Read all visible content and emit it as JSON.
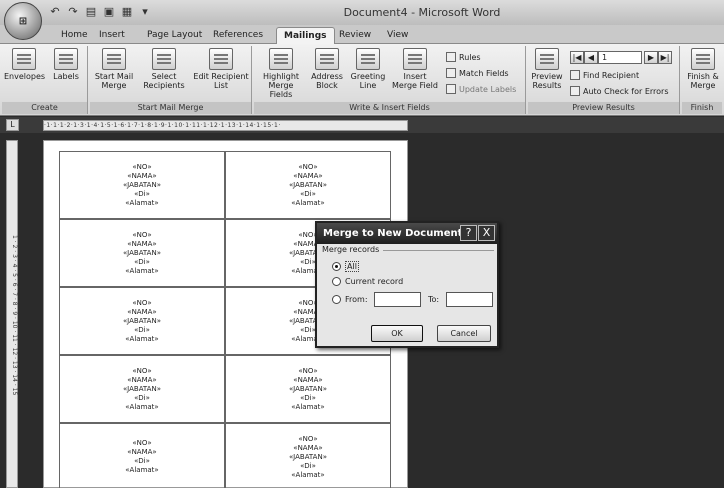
{
  "app": {
    "office_button_label": "Office",
    "qat_icons": [
      "save-icon",
      "undo-icon",
      "redo-icon",
      "open-icon",
      "print-icon"
    ],
    "title": "Document4 - Microsoft Word"
  },
  "tabs": [
    "Home",
    "Insert",
    "Page Layout",
    "References",
    "Mailings",
    "Review",
    "View"
  ],
  "active_tab": "Mailings",
  "ribbon": {
    "create": {
      "label": "Create",
      "envelopes": "Envelopes",
      "labels": "Labels"
    },
    "start_mail_merge": {
      "label": "Start Mail Merge",
      "start": "Start Mail Merge",
      "select": "Select Recipients",
      "edit": "Edit Recipient List"
    },
    "write_insert": {
      "label": "Write & Insert Fields",
      "highlight": "Highlight Merge Fields",
      "address": "Address Block",
      "greeting": "Greeting Line",
      "insert_field": "Insert Merge Field",
      "rules": "Rules",
      "match": "Match Fields",
      "update": "Update Labels"
    },
    "preview": {
      "label": "Preview Results",
      "preview_btn": "Preview Results",
      "record_value": "1",
      "find": "Find Recipient",
      "auto_check": "Auto Check for Errors"
    },
    "finish": {
      "label": "Finish",
      "finish_btn": "Finish & Merge"
    }
  },
  "ruler": {
    "horizontal": "·1·1·1·2·1·3·1·4·1·5·1·6·1·7·1·8·1·9·1·10·1·11·1·12·1·13·1·14·1·15·1·",
    "vertical": "1 · 2 · 3 · 4 · 5 · 6 · 7 · 8 · 9 · 10 · 11 · 12 · 13 · 14 · 15"
  },
  "document": {
    "label_lines": [
      "«NO»",
      "«NAMA»",
      "«JABATAN»",
      "«Di»",
      "«Alamat»"
    ],
    "last_label_lines": [
      "«NO»",
      "«NAMA»",
      "«Di»",
      "«Alamat»"
    ]
  },
  "dialog": {
    "title": "Merge to New Document",
    "help": "?",
    "close": "X",
    "group_label": "Merge records",
    "opt_all": "All",
    "opt_current": "Current record",
    "opt_from": "From:",
    "to_label": "To:",
    "from_value": "",
    "to_value": "",
    "ok": "OK",
    "cancel": "Cancel"
  }
}
